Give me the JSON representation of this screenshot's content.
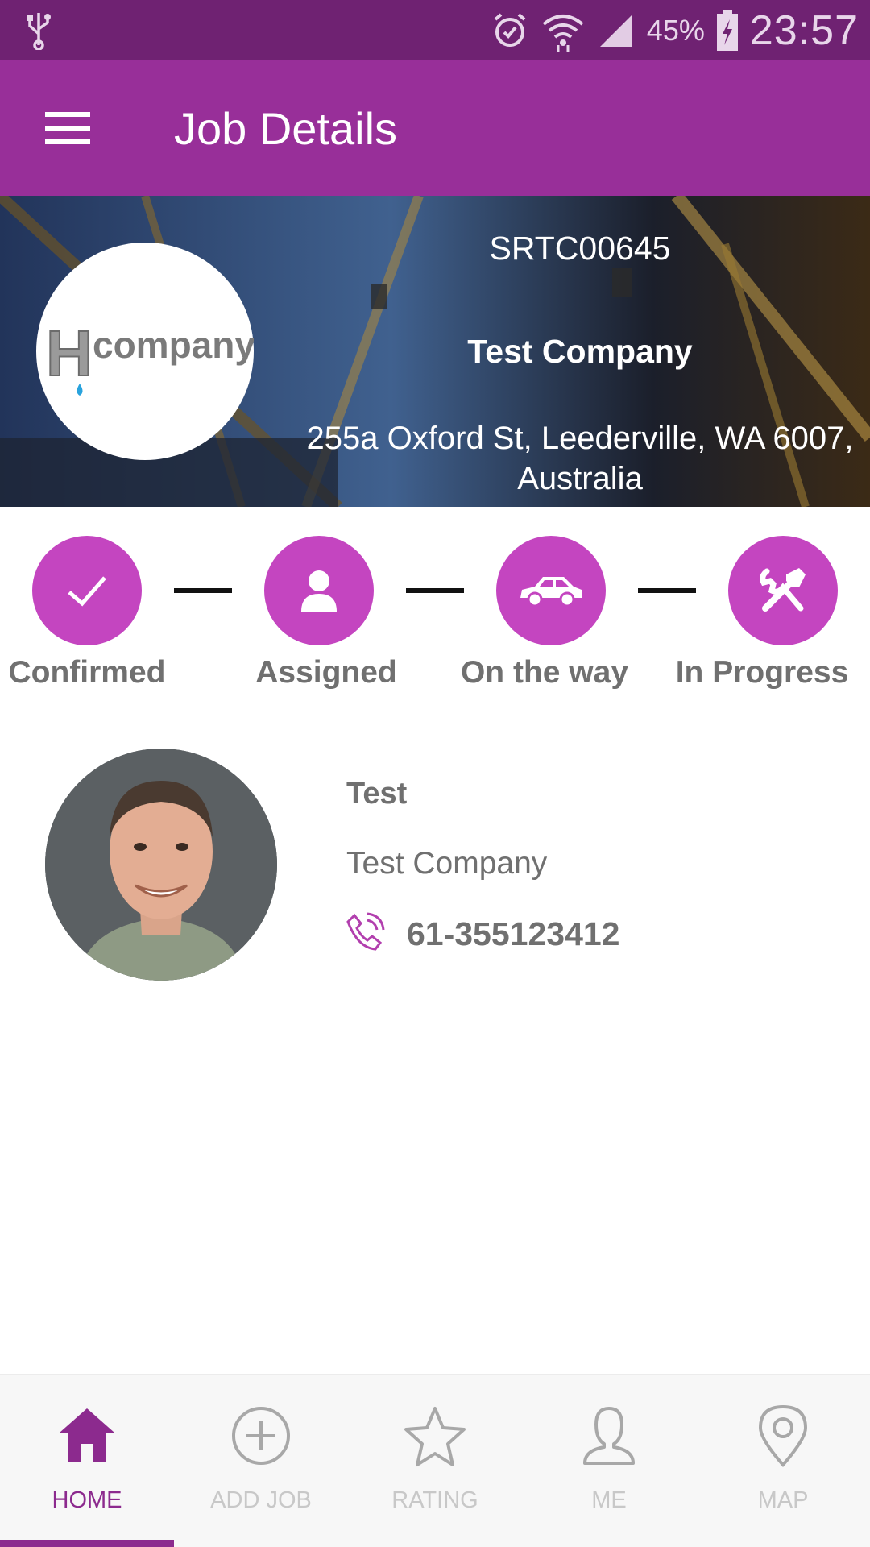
{
  "status_bar": {
    "battery_percent": "45%",
    "time": "23:57",
    "icons": [
      "usb-icon",
      "alarm-icon",
      "wifi-icon",
      "signal-icon",
      "battery-charging-icon"
    ]
  },
  "app_bar": {
    "title": "Job Details",
    "menu_icon": "hamburger-menu-icon"
  },
  "job": {
    "id": "SRTC00645",
    "company": "Test Company",
    "address": "255a Oxford St, Leederville, WA 6007, Australia",
    "logo": {
      "initial": "H",
      "word": "company"
    }
  },
  "steps": [
    {
      "label": "Confirmed",
      "icon": "check-icon"
    },
    {
      "label": "Assigned",
      "icon": "person-icon"
    },
    {
      "label": "On the way",
      "icon": "car-icon"
    },
    {
      "label": "In Progress",
      "icon": "tools-icon"
    }
  ],
  "contact": {
    "name": "Test",
    "company": "Test Company",
    "phone": "61-355123412",
    "phone_icon": "phone-icon"
  },
  "bottom_nav": {
    "items": [
      {
        "label": "HOME",
        "icon": "home-icon",
        "active": true
      },
      {
        "label": "ADD JOB",
        "icon": "add-circle-icon",
        "active": false
      },
      {
        "label": "RATING",
        "icon": "star-icon",
        "active": false
      },
      {
        "label": "ME",
        "icon": "person-outline-icon",
        "active": false
      },
      {
        "label": "MAP",
        "icon": "map-pin-icon",
        "active": false
      }
    ]
  },
  "colors": {
    "status_bar": "#6f2272",
    "app_bar": "#982f99",
    "step_circle": "#c445c0",
    "active_nav": "#8c2a8e",
    "inactive_nav": "#c8c8c8",
    "text_gray": "#707070"
  }
}
